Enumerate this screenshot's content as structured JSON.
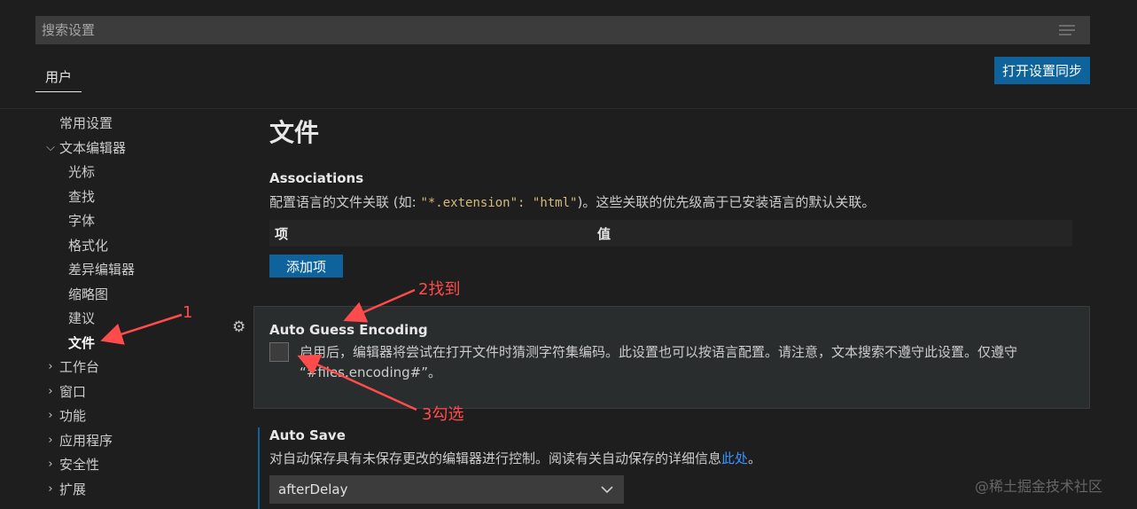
{
  "search": {
    "placeholder": "搜索设置"
  },
  "tabs": {
    "user": "用户"
  },
  "sync_button": "打开设置同步",
  "sidebar": {
    "items": [
      {
        "label": "常用设置"
      },
      {
        "label": "文本编辑器",
        "expanded": true
      },
      {
        "label": "光标"
      },
      {
        "label": "查找"
      },
      {
        "label": "字体"
      },
      {
        "label": "格式化"
      },
      {
        "label": "差异编辑器"
      },
      {
        "label": "缩略图"
      },
      {
        "label": "建议"
      },
      {
        "label": "文件",
        "active": true
      },
      {
        "label": "工作台"
      },
      {
        "label": "窗口"
      },
      {
        "label": "功能"
      },
      {
        "label": "应用程序"
      },
      {
        "label": "安全性"
      },
      {
        "label": "扩展"
      }
    ]
  },
  "main": {
    "title": "文件",
    "associations": {
      "title": "Associations",
      "desc_before": "配置语言的文件关联 (如: ",
      "desc_code": "\"*.extension\": \"html\"",
      "desc_after": ")。这些关联的优先级高于已安装语言的默认关联。",
      "col_item": "项",
      "col_value": "值",
      "add_button": "添加项"
    },
    "auto_guess": {
      "title": "Auto Guess Encoding",
      "checked": false,
      "desc": "启用后，编辑器将尝试在打开文件时猜测字符集编码。此设置也可以按语言配置。请注意，文本搜索不遵守此设置。仅遵守 “#files.encoding#”。"
    },
    "auto_save": {
      "title": "Auto Save",
      "desc_before": "对自动保存具有未保存更改的编辑器进行控制。阅读有关自动保存的详细信息",
      "link": "此处",
      "desc_after": "。",
      "value": "afterDelay"
    }
  },
  "annotations": {
    "a1": "1",
    "a2": "2找到",
    "a3": "3勾选"
  },
  "watermark": "@稀土掘金技术社区",
  "colors": {
    "accent": "#0e639c",
    "annotation": "#ff4b4b",
    "link": "#3794ff"
  }
}
